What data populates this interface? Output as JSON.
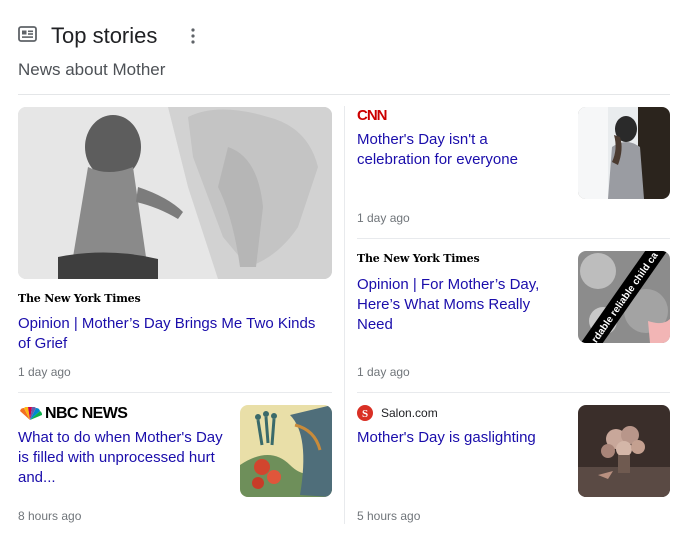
{
  "header": {
    "title": "Top stories",
    "subtitle": "News about Mother"
  },
  "icons": {
    "news": "news-icon",
    "menu": "more-vert-icon"
  },
  "colors": {
    "headline": "#1a0dab",
    "cnn_red": "#cc0000",
    "salon_red": "#d93025"
  },
  "stories": [
    {
      "source": "The New York Times",
      "headline": "Opinion | Mother’s Day Brings Me Two Kinds of Grief",
      "time": "1 day ago"
    },
    {
      "source": "CNN",
      "headline": "Mother's Day isn't a celebration for everyone",
      "time": "1 day ago"
    },
    {
      "source": "The New York Times",
      "headline": "Opinion | For Mother’s Day, Here’s What Moms Really Need",
      "time": "1 day ago",
      "image_text": "rdable reliable child ca"
    },
    {
      "source": "NBC NEWS",
      "headline": "What to do when Mother's Day is filled with unprocessed hurt and...",
      "time": "8 hours ago"
    },
    {
      "source": "Salon.com",
      "source_icon_letter": "S",
      "headline": "Mother's Day is gaslighting",
      "time": "5 hours ago"
    }
  ]
}
